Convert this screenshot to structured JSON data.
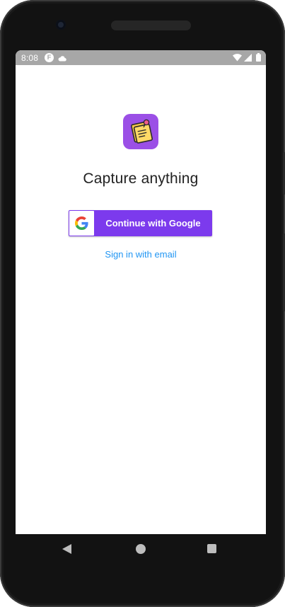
{
  "status_bar": {
    "time": "8:08",
    "notification_glyph": "F",
    "icons": [
      "cloud-icon",
      "wifi-icon",
      "signal-icon",
      "battery-icon"
    ]
  },
  "app": {
    "icon": "sticky-note-icon",
    "title": "Capture anything"
  },
  "auth": {
    "google_button_label": "Continue with Google",
    "google_logo": "google-g-icon",
    "email_link_label": "Sign in with email"
  },
  "nav_bar": {
    "buttons": [
      "back-icon",
      "home-icon",
      "recents-icon"
    ]
  },
  "colors": {
    "primary": "#7c3aed",
    "app_icon_bg": "#9b4fe6",
    "link": "#2196f3",
    "status_bar_bg": "#a7a7a7"
  }
}
